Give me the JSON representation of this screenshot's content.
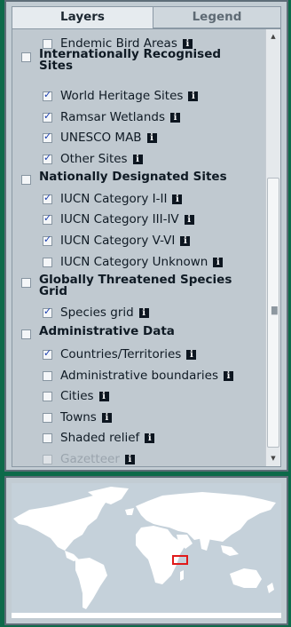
{
  "tabs": [
    {
      "label": "Layers",
      "active": true
    },
    {
      "label": "Legend",
      "active": false
    }
  ],
  "layers": [
    {
      "label": "Endemic Bird Areas",
      "type": "item",
      "checked": false,
      "info": true
    },
    {
      "label": "Internationally Recognised Sites",
      "type": "group",
      "checked": false
    },
    {
      "label": "World Heritage Sites",
      "type": "item",
      "checked": true,
      "info": true
    },
    {
      "label": "Ramsar Wetlands",
      "type": "item",
      "checked": true,
      "info": true
    },
    {
      "label": "UNESCO MAB",
      "type": "item",
      "checked": true,
      "info": true
    },
    {
      "label": "Other Sites",
      "type": "item",
      "checked": true,
      "info": true
    },
    {
      "label": "Nationally Designated Sites",
      "type": "group",
      "checked": false
    },
    {
      "label": "IUCN Category I-II",
      "type": "item",
      "checked": true,
      "info": true
    },
    {
      "label": "IUCN Category III-IV",
      "type": "item",
      "checked": true,
      "info": true
    },
    {
      "label": "IUCN Category V-VI",
      "type": "item",
      "checked": true,
      "info": true
    },
    {
      "label": "IUCN Category Unknown",
      "type": "item",
      "checked": false,
      "info": true
    },
    {
      "label": "Globally Threatened Species Grid",
      "type": "group",
      "checked": false
    },
    {
      "label": "Species grid",
      "type": "item",
      "checked": true,
      "info": true
    },
    {
      "label": "Administrative Data",
      "type": "group",
      "checked": false
    },
    {
      "label": "Countries/Territories",
      "type": "item",
      "checked": true,
      "info": true
    },
    {
      "label": "Administrative boundaries",
      "type": "item",
      "checked": false,
      "info": true
    },
    {
      "label": "Cities",
      "type": "item",
      "checked": false,
      "info": true
    },
    {
      "label": "Towns",
      "type": "item",
      "checked": false,
      "info": true
    },
    {
      "label": "Shaded relief",
      "type": "item",
      "checked": false,
      "info": true
    },
    {
      "label": "Gazetteer",
      "type": "item",
      "checked": false,
      "info": true,
      "disabled": true
    }
  ],
  "info_glyph": "i",
  "icons": {
    "info": "info-icon",
    "scroll_up": "scroll-up-arrow-icon",
    "scroll_down": "scroll-down-arrow-icon"
  },
  "colors": {
    "page_background": "#0d6a4a",
    "panel_background": "#c0c9d0",
    "check_mark": "#1b3fae",
    "overview_extent": "#e01a1a",
    "land": "#ffffff",
    "ocean": "#c5d1da"
  }
}
